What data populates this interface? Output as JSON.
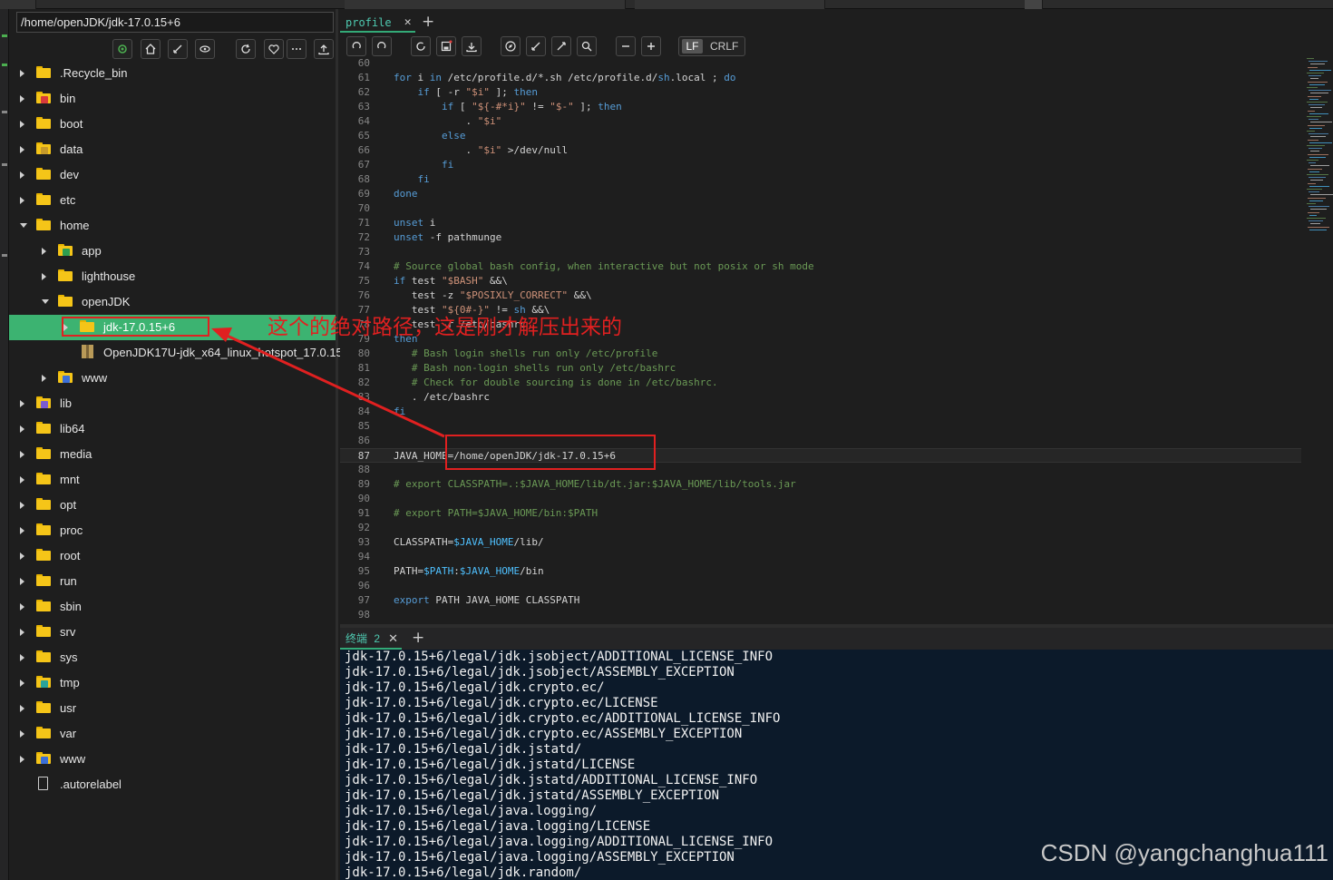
{
  "file_panel": {
    "path": "/home/openJDK/jdk-17.0.15+6",
    "tree": [
      {
        "label": ".Recycle_bin",
        "icon": "folder-icon",
        "depth": 0,
        "state": "collapsed"
      },
      {
        "label": "bin",
        "icon": "folder-bin-icon",
        "depth": 0,
        "state": "collapsed"
      },
      {
        "label": "boot",
        "icon": "folder-icon",
        "depth": 0,
        "state": "collapsed"
      },
      {
        "label": "data",
        "icon": "folder-data-icon",
        "depth": 0,
        "state": "collapsed"
      },
      {
        "label": "dev",
        "icon": "folder-icon",
        "depth": 0,
        "state": "collapsed"
      },
      {
        "label": "etc",
        "icon": "folder-icon",
        "depth": 0,
        "state": "collapsed"
      },
      {
        "label": "home",
        "icon": "folder-icon",
        "depth": 0,
        "state": "expanded"
      },
      {
        "label": "app",
        "icon": "folder-app-icon",
        "depth": 1,
        "state": "collapsed"
      },
      {
        "label": "lighthouse",
        "icon": "folder-icon",
        "depth": 1,
        "state": "collapsed"
      },
      {
        "label": "openJDK",
        "icon": "folder-icon",
        "depth": 1,
        "state": "expanded"
      },
      {
        "label": "jdk-17.0.15+6",
        "icon": "folder-icon",
        "depth": 2,
        "state": "selected"
      },
      {
        "label": "OpenJDK17U-jdk_x64_linux_hotspot_17.0.15_",
        "icon": "archive-icon",
        "depth": 2,
        "state": "file"
      },
      {
        "label": "www",
        "icon": "folder-www-icon",
        "depth": 1,
        "state": "collapsed"
      },
      {
        "label": "lib",
        "icon": "folder-lib-icon",
        "depth": 0,
        "state": "collapsed"
      },
      {
        "label": "lib64",
        "icon": "folder-icon",
        "depth": 0,
        "state": "collapsed"
      },
      {
        "label": "media",
        "icon": "folder-icon",
        "depth": 0,
        "state": "collapsed"
      },
      {
        "label": "mnt",
        "icon": "folder-icon",
        "depth": 0,
        "state": "collapsed"
      },
      {
        "label": "opt",
        "icon": "folder-icon",
        "depth": 0,
        "state": "collapsed"
      },
      {
        "label": "proc",
        "icon": "folder-icon",
        "depth": 0,
        "state": "collapsed"
      },
      {
        "label": "root",
        "icon": "folder-icon",
        "depth": 0,
        "state": "collapsed"
      },
      {
        "label": "run",
        "icon": "folder-icon",
        "depth": 0,
        "state": "collapsed"
      },
      {
        "label": "sbin",
        "icon": "folder-icon",
        "depth": 0,
        "state": "collapsed"
      },
      {
        "label": "srv",
        "icon": "folder-icon",
        "depth": 0,
        "state": "collapsed"
      },
      {
        "label": "sys",
        "icon": "folder-icon",
        "depth": 0,
        "state": "collapsed"
      },
      {
        "label": "tmp",
        "icon": "folder-tmp-icon",
        "depth": 0,
        "state": "collapsed"
      },
      {
        "label": "usr",
        "icon": "folder-icon",
        "depth": 0,
        "state": "collapsed"
      },
      {
        "label": "var",
        "icon": "folder-icon",
        "depth": 0,
        "state": "collapsed"
      },
      {
        "label": "www",
        "icon": "folder-www-icon",
        "depth": 0,
        "state": "collapsed"
      },
      {
        "label": ".autorelabel",
        "icon": "file-icon",
        "depth": 0,
        "state": "file"
      }
    ]
  },
  "editor": {
    "tab_label": "profile",
    "lf_label": "LF",
    "crlf_label": "CRLF",
    "current_line": 87,
    "lines": [
      {
        "n": "60",
        "t": [
          [
            "",
            ""
          ]
        ]
      },
      {
        "n": "61",
        "t": [
          [
            "k",
            "for"
          ],
          [
            "",
            " i "
          ],
          [
            "k",
            "in"
          ],
          [
            "",
            " /etc/profile.d/*.sh /etc/profile.d/"
          ],
          [
            "k",
            "sh"
          ],
          [
            "",
            ".local ; "
          ],
          [
            "k",
            "do"
          ]
        ]
      },
      {
        "n": "62",
        "t": [
          [
            "",
            "    "
          ],
          [
            "k",
            "if"
          ],
          [
            "",
            " [ -r "
          ],
          [
            "s",
            "\"$i\""
          ],
          [
            "",
            " ]; "
          ],
          [
            "k",
            "then"
          ]
        ]
      },
      {
        "n": "63",
        "t": [
          [
            "",
            "        "
          ],
          [
            "k",
            "if"
          ],
          [
            "",
            " [ "
          ],
          [
            "s",
            "\"${-#*i}\""
          ],
          [
            "",
            " != "
          ],
          [
            "s",
            "\"$-\""
          ],
          [
            "",
            " ]; "
          ],
          [
            "k",
            "then"
          ]
        ]
      },
      {
        "n": "64",
        "t": [
          [
            "",
            "            . "
          ],
          [
            "s",
            "\"$i\""
          ]
        ]
      },
      {
        "n": "65",
        "t": [
          [
            "",
            "        "
          ],
          [
            "k",
            "else"
          ]
        ]
      },
      {
        "n": "66",
        "t": [
          [
            "",
            "            . "
          ],
          [
            "s",
            "\"$i\""
          ],
          [
            "",
            " >/dev/null"
          ]
        ]
      },
      {
        "n": "67",
        "t": [
          [
            "",
            "        "
          ],
          [
            "k",
            "fi"
          ]
        ]
      },
      {
        "n": "68",
        "t": [
          [
            "",
            "    "
          ],
          [
            "k",
            "fi"
          ]
        ]
      },
      {
        "n": "69",
        "t": [
          [
            "k",
            "done"
          ]
        ]
      },
      {
        "n": "70",
        "t": [
          [
            "",
            ""
          ]
        ]
      },
      {
        "n": "71",
        "t": [
          [
            "k",
            "unset"
          ],
          [
            "",
            " i"
          ]
        ]
      },
      {
        "n": "72",
        "t": [
          [
            "k",
            "unset"
          ],
          [
            "",
            " -f pathmunge"
          ]
        ]
      },
      {
        "n": "73",
        "t": [
          [
            "",
            ""
          ]
        ]
      },
      {
        "n": "74",
        "t": [
          [
            "c",
            "# Source global bash config, when interactive but not posix or sh mode"
          ]
        ]
      },
      {
        "n": "75",
        "t": [
          [
            "k",
            "if"
          ],
          [
            "",
            " test "
          ],
          [
            "s",
            "\"$BASH\""
          ],
          [
            "",
            " &&\\"
          ]
        ]
      },
      {
        "n": "76",
        "t": [
          [
            "",
            "   test -z "
          ],
          [
            "s",
            "\"$POSIXLY_CORRECT\""
          ],
          [
            "",
            " &&\\"
          ]
        ]
      },
      {
        "n": "77",
        "t": [
          [
            "",
            "   test "
          ],
          [
            "s",
            "\"${0#-}\""
          ],
          [
            "",
            " != "
          ],
          [
            "k",
            "sh"
          ],
          [
            "",
            " &&\\"
          ]
        ]
      },
      {
        "n": "78",
        "t": [
          [
            "",
            "   test -r /etc/bashrc"
          ]
        ]
      },
      {
        "n": "79",
        "t": [
          [
            "k",
            "then"
          ]
        ]
      },
      {
        "n": "80",
        "t": [
          [
            "",
            "   "
          ],
          [
            "c",
            "# Bash login shells run only /etc/profile"
          ]
        ]
      },
      {
        "n": "81",
        "t": [
          [
            "",
            "   "
          ],
          [
            "c",
            "# Bash non-login shells run only /etc/bashrc"
          ]
        ]
      },
      {
        "n": "82",
        "t": [
          [
            "",
            "   "
          ],
          [
            "c",
            "# Check for double sourcing is done in /etc/bashrc."
          ]
        ]
      },
      {
        "n": "83",
        "t": [
          [
            "",
            "   . /etc/bashrc"
          ]
        ]
      },
      {
        "n": "84",
        "t": [
          [
            "k",
            "fi"
          ]
        ]
      },
      {
        "n": "85",
        "t": [
          [
            "",
            ""
          ]
        ]
      },
      {
        "n": "86",
        "t": [
          [
            "",
            ""
          ]
        ]
      },
      {
        "n": "87",
        "t": [
          [
            "",
            "JAVA_HOME=/home/openJDK/jdk-17.0.15+6"
          ]
        ]
      },
      {
        "n": "88",
        "t": [
          [
            "",
            ""
          ]
        ]
      },
      {
        "n": "89",
        "t": [
          [
            "c",
            "# export CLASSPATH=.:$JAVA_HOME/lib/dt.jar:$JAVA_HOME/lib/tools.jar"
          ]
        ]
      },
      {
        "n": "90",
        "t": [
          [
            "",
            ""
          ]
        ]
      },
      {
        "n": "91",
        "t": [
          [
            "c",
            "# export PATH=$JAVA_HOME/bin:$PATH"
          ]
        ]
      },
      {
        "n": "92",
        "t": [
          [
            "",
            ""
          ]
        ]
      },
      {
        "n": "93",
        "t": [
          [
            "",
            "CLASSPATH="
          ],
          [
            "v",
            "$JAVA_HOME"
          ],
          [
            "",
            "/lib/"
          ]
        ]
      },
      {
        "n": "94",
        "t": [
          [
            "",
            ""
          ]
        ]
      },
      {
        "n": "95",
        "t": [
          [
            "",
            "PATH="
          ],
          [
            "v",
            "$PATH"
          ],
          [
            "",
            ":"
          ],
          [
            "v",
            "$JAVA_HOME"
          ],
          [
            "",
            "/bin"
          ]
        ]
      },
      {
        "n": "96",
        "t": [
          [
            "",
            ""
          ]
        ]
      },
      {
        "n": "97",
        "t": [
          [
            "k",
            "export"
          ],
          [
            "",
            " PATH JAVA_HOME CLASSPATH"
          ]
        ]
      },
      {
        "n": "98",
        "t": [
          [
            "",
            ""
          ]
        ]
      }
    ]
  },
  "terminal": {
    "tab_label": "终端",
    "tab_count": "2",
    "lines": [
      "jdk-17.0.15+6/legal/jdk.jsobject/ADDITIONAL_LICENSE_INFO",
      "jdk-17.0.15+6/legal/jdk.jsobject/ASSEMBLY_EXCEPTION",
      "jdk-17.0.15+6/legal/jdk.crypto.ec/",
      "jdk-17.0.15+6/legal/jdk.crypto.ec/LICENSE",
      "jdk-17.0.15+6/legal/jdk.crypto.ec/ADDITIONAL_LICENSE_INFO",
      "jdk-17.0.15+6/legal/jdk.crypto.ec/ASSEMBLY_EXCEPTION",
      "jdk-17.0.15+6/legal/jdk.jstatd/",
      "jdk-17.0.15+6/legal/jdk.jstatd/LICENSE",
      "jdk-17.0.15+6/legal/jdk.jstatd/ADDITIONAL_LICENSE_INFO",
      "jdk-17.0.15+6/legal/jdk.jstatd/ASSEMBLY_EXCEPTION",
      "jdk-17.0.15+6/legal/java.logging/",
      "jdk-17.0.15+6/legal/java.logging/LICENSE",
      "jdk-17.0.15+6/legal/java.logging/ADDITIONAL_LICENSE_INFO",
      "jdk-17.0.15+6/legal/java.logging/ASSEMBLY_EXCEPTION",
      "jdk-17.0.15+6/legal/jdk.random/"
    ]
  },
  "annotation": {
    "text": "这个的绝对路径，这是刚才解压出来的",
    "color": "#e02020"
  },
  "watermark": "CSDN @yangchanghua111",
  "colors": {
    "selection": "#3cb371",
    "folder": "#f5c518",
    "accent": "#4ec9b0"
  }
}
